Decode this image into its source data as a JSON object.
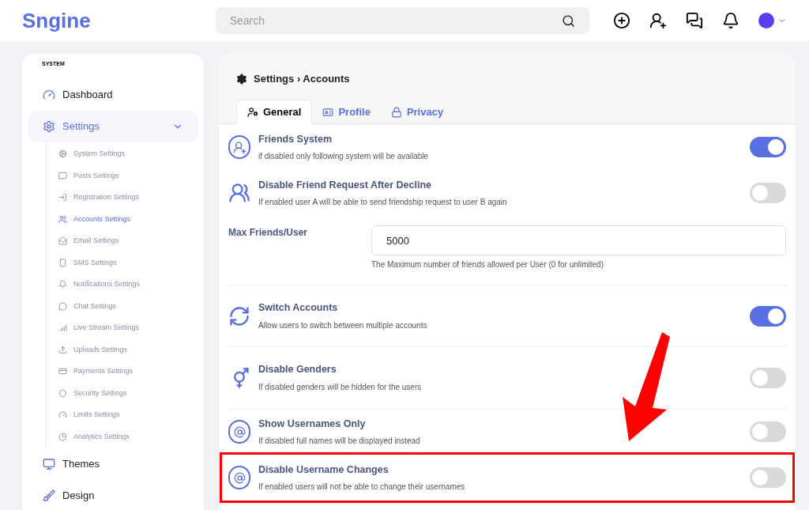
{
  "header": {
    "logo": "Sngine",
    "search": {
      "placeholder": "Search"
    }
  },
  "sidebar": {
    "section": "SYSTEM",
    "items": [
      {
        "label": "Dashboard",
        "selected": false
      },
      {
        "label": "Settings",
        "selected": true,
        "expanded": true,
        "children": [
          {
            "label": "System Settings",
            "selected": false
          },
          {
            "label": "Posts Settings",
            "selected": false
          },
          {
            "label": "Registration Settings",
            "selected": false
          },
          {
            "label": "Accounts Settings",
            "selected": true
          },
          {
            "label": "Email Settings",
            "selected": false
          },
          {
            "label": "SMS Settings",
            "selected": false
          },
          {
            "label": "Notifications Settings",
            "selected": false
          },
          {
            "label": "Chat Settings",
            "selected": false
          },
          {
            "label": "Live Stream Settings",
            "selected": false
          },
          {
            "label": "Uploads Settings",
            "selected": false
          },
          {
            "label": "Payments Settings",
            "selected": false
          },
          {
            "label": "Security Settings",
            "selected": false
          },
          {
            "label": "Limits Settings",
            "selected": false
          },
          {
            "label": "Analytics Settings",
            "selected": false
          }
        ]
      },
      {
        "label": "Themes",
        "selected": false
      },
      {
        "label": "Design",
        "selected": false
      }
    ]
  },
  "main": {
    "breadcrumb": "Settings › Accounts",
    "tabs": [
      {
        "label": "General",
        "selected": true
      },
      {
        "label": "Profile",
        "selected": false
      },
      {
        "label": "Privacy",
        "selected": false
      }
    ],
    "rows": [
      {
        "kind": "toggle",
        "title": "Friends System",
        "description": "if disabled only following system will be available",
        "on": true,
        "highlighted": false,
        "divider": false
      },
      {
        "kind": "toggle",
        "title": "Disable Friend Request After Decline",
        "description": "If enabled user A will be able to send friendship request to user B again",
        "on": false,
        "highlighted": false,
        "divider": false
      },
      {
        "kind": "number",
        "title": "Max Friends/User",
        "value": "5000",
        "hint": "The Maximum number of friends allowed per User (0 for unlimited)",
        "divider": true
      },
      {
        "kind": "toggle",
        "title": "Switch Accounts",
        "description": "Allow users to switch between multiple accounts",
        "on": true,
        "highlighted": false,
        "divider": true
      },
      {
        "kind": "toggle",
        "title": "Disable Genders",
        "description": "If disabled genders will be hidden for the users",
        "on": false,
        "highlighted": false,
        "divider": true
      },
      {
        "kind": "toggle",
        "title": "Show Usernames Only",
        "description": "If disabled full names will be displayed instead",
        "on": false,
        "highlighted": false,
        "divider": false
      },
      {
        "kind": "toggle",
        "title": "Disable Username Changes",
        "description": "If enabled users will not be able to change their usernames",
        "on": false,
        "highlighted": true,
        "divider": false
      }
    ]
  }
}
